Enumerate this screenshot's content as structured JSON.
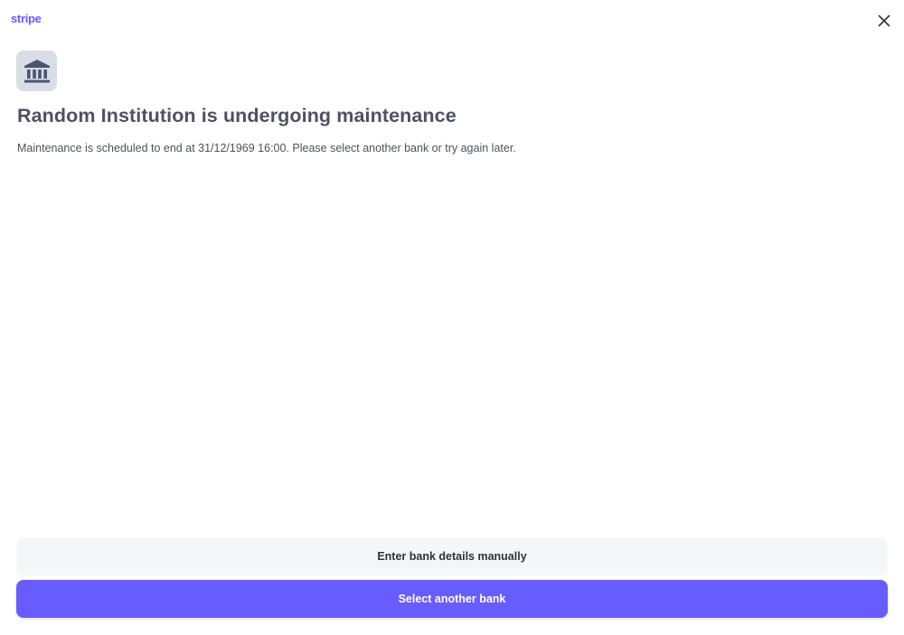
{
  "header": {
    "logo_text": "stripe",
    "close_icon": "close-icon"
  },
  "status": {
    "icon": "bank-icon",
    "title": "Random Institution is undergoing maintenance",
    "message": "Maintenance is scheduled to end at 31/12/1969 16:00. Please select another bank or try again later."
  },
  "actions": {
    "manual_label": "Enter bank details manually",
    "select_label": "Select another bank"
  },
  "colors": {
    "brand": "#635bff",
    "primary_button": "#675dff",
    "secondary_button": "#f5f6f8",
    "icon_tile": "#d8dde6",
    "icon_fill": "#4a5576",
    "text": "#4d5261"
  }
}
